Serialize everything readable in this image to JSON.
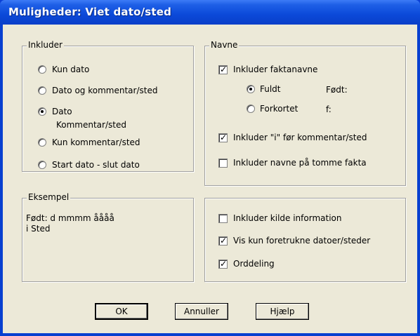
{
  "window": {
    "title": "Muligheder:  Viet dato/sted"
  },
  "include_group": {
    "legend": "Inkluder",
    "options": [
      {
        "label": "Kun dato",
        "checked": false
      },
      {
        "label": "Dato og kommentar/sted",
        "checked": false
      },
      {
        "label": "Dato",
        "label2": "Kommentar/sted",
        "checked": true
      },
      {
        "label": "Kun kommentar/sted",
        "checked": false
      },
      {
        "label": "Start dato - slut dato",
        "checked": false
      }
    ]
  },
  "names_group": {
    "legend": "Navne",
    "include_fact_names": {
      "label": "Inkluder faktanavne",
      "checked": true
    },
    "full_radio": {
      "label": "Fuldt",
      "checked": true
    },
    "short_radio": {
      "label": "Forkortet",
      "checked": false
    },
    "full_example": "Født:",
    "short_example": "f:",
    "include_i": {
      "label": "Inkluder \"i\" før kommentar/sted",
      "checked": true
    },
    "include_empty": {
      "label": "Inkluder navne på tomme fakta",
      "checked": false
    }
  },
  "example_group": {
    "legend": "Eksempel",
    "line1": "Født: d mmmm åååå",
    "line2": "i Sted"
  },
  "options_group": {
    "include_source": {
      "label": "Inkluder kilde information",
      "checked": false
    },
    "preferred_only": {
      "label": "Vis kun foretrukne datoer/steder",
      "checked": true
    },
    "hyphenation": {
      "label": "Orddeling",
      "checked": true
    }
  },
  "buttons": {
    "ok": "OK",
    "cancel": "Annuller",
    "help": "Hjælp"
  }
}
